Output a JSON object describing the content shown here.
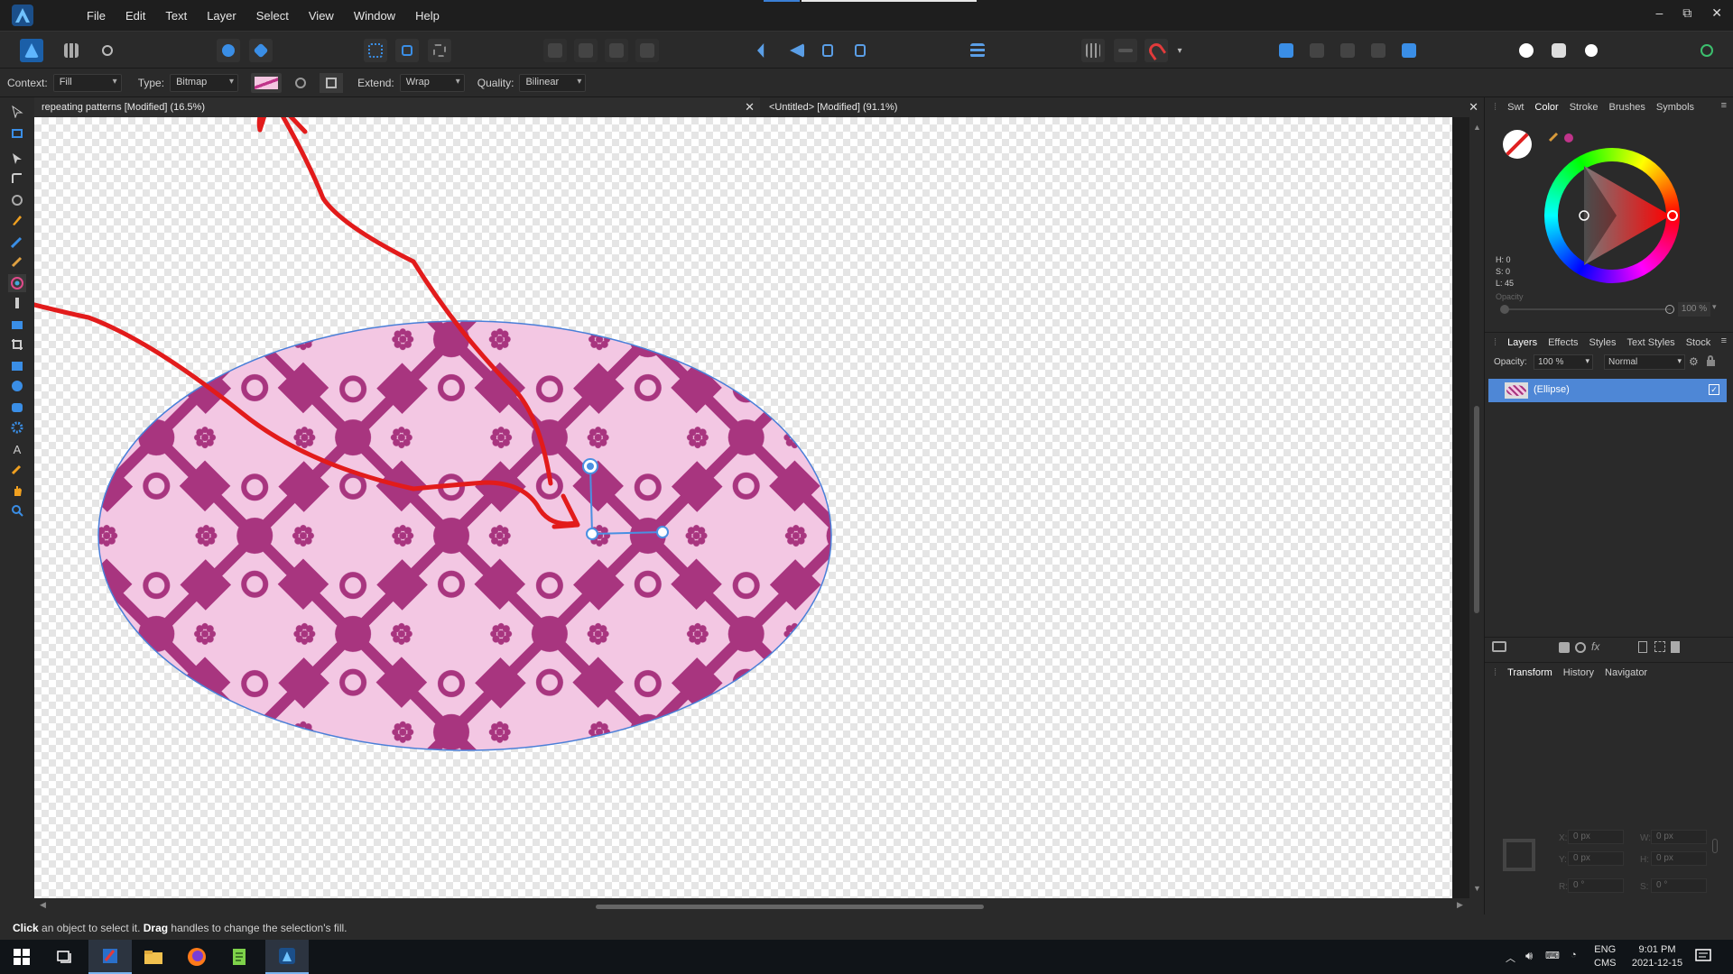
{
  "app": {
    "menu": [
      "File",
      "Edit",
      "Text",
      "Layer",
      "Select",
      "View",
      "Window",
      "Help"
    ],
    "window_controls": [
      "–",
      "⧉",
      "✕"
    ]
  },
  "context_bar": {
    "context_label": "Context:",
    "context_value": "Fill",
    "type_label": "Type:",
    "type_value": "Bitmap",
    "extend_label": "Extend:",
    "extend_value": "Wrap",
    "quality_label": "Quality:",
    "quality_value": "Bilinear"
  },
  "doc_tabs": [
    {
      "title": "repeating patterns [Modified] (16.5%)",
      "active": true
    },
    {
      "title": "<Untitled> [Modified] (91.1%)",
      "active": false
    }
  ],
  "color_panel": {
    "tabs": [
      "Swt",
      "Color",
      "Stroke",
      "Brushes",
      "Symbols"
    ],
    "active_tab": "Color",
    "h": "H: 0",
    "s": "S: 0",
    "l": "L: 45",
    "opacity_label": "Opacity",
    "opacity_value": "100 %",
    "accent_color": "#c0348a"
  },
  "layers_panel": {
    "tabs": [
      "Layers",
      "Effects",
      "Styles",
      "Text Styles",
      "Stock"
    ],
    "active_tab": "Layers",
    "opacity_label": "Opacity:",
    "opacity_value": "100 %",
    "blend_mode": "Normal",
    "layers": [
      {
        "name": "(Ellipse)",
        "selected": true,
        "visible": true
      }
    ]
  },
  "transform_panel": {
    "tabs": [
      "Transform",
      "History",
      "Navigator"
    ],
    "active_tab": "Transform",
    "x_label": "X:",
    "x": "0 px",
    "y_label": "Y:",
    "y": "0 px",
    "w_label": "W:",
    "w": "0 px",
    "h_label": "H:",
    "h": "0 px",
    "r_label": "R:",
    "r": "0 °",
    "s_label": "S:",
    "s": "0 °"
  },
  "status": {
    "click": "Click",
    "click_rest": " an object to select it. ",
    "drag": "Drag",
    "drag_rest": " handles to change the selection's fill."
  },
  "taskbar": {
    "lang_top": "ENG",
    "lang_bottom": "CMS",
    "time": "9:01 PM",
    "date": "2021-12-15"
  },
  "colors": {
    "pattern_dark": "#a8357f",
    "pattern_light": "#f3c7e3",
    "annotation": "#e21b1b",
    "selection_blue": "#4a90e2"
  }
}
